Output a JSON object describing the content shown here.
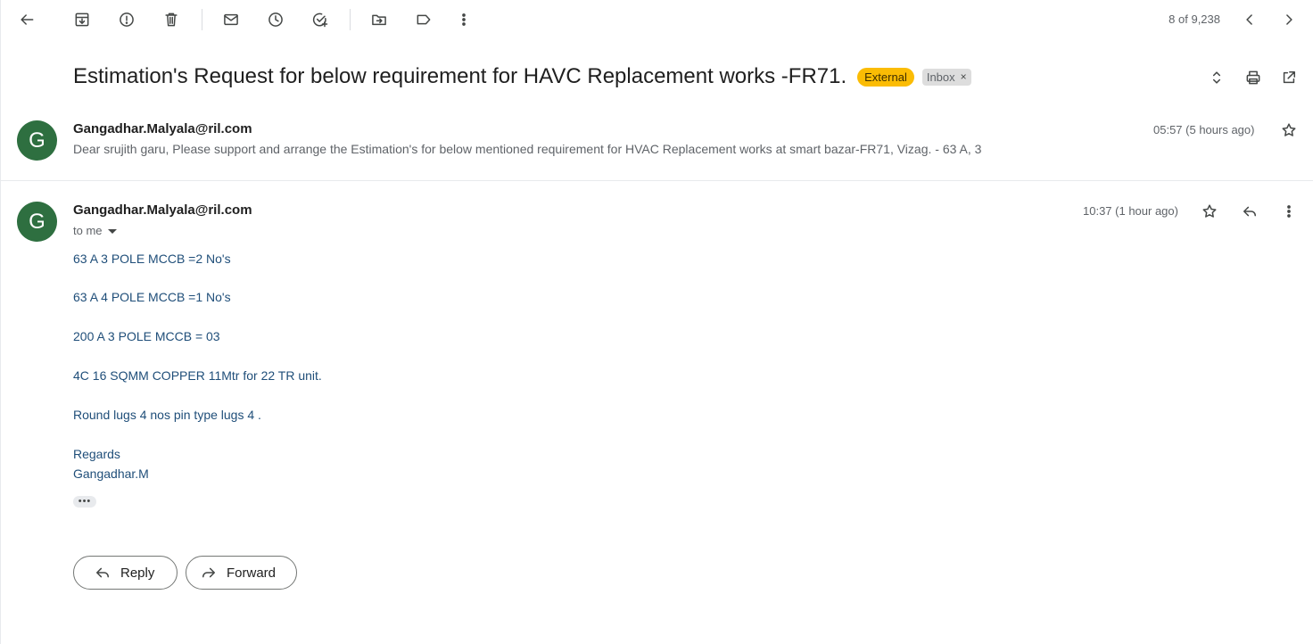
{
  "toolbar": {
    "icons": [
      "back-arrow-icon",
      "archive-icon",
      "report-spam-icon",
      "delete-icon",
      "mark-unread-icon",
      "snooze-icon",
      "add-to-tasks-icon",
      "move-to-icon",
      "label-icon",
      "more-vertical-icon"
    ],
    "counter": "8 of 9,238"
  },
  "subject": {
    "title": "Estimation's Request for below requirement for HAVC Replacement works -FR71.",
    "badge_external": "External",
    "badge_inbox": "Inbox",
    "badge_remove": "×"
  },
  "messages": [
    {
      "avatar_letter": "G",
      "avatar_color": "#2e6f40",
      "sender": "Gangadhar.Malyala@ril.com",
      "time": "05:57 (5 hours ago)",
      "snippet": "Dear srujith garu, Please support and arrange the Estimation's for below mentioned requirement for HVAC Replacement works at smart bazar-FR71, Vizag. - 63 A, 3"
    },
    {
      "avatar_letter": "G",
      "avatar_color": "#2e6f40",
      "sender": "Gangadhar.Malyala@ril.com",
      "time": "10:37 (1 hour ago)",
      "to": "to me",
      "body_lines": [
        "63 A 3 POLE MCCB =2 No's",
        "63 A 4 POLE MCCB =1 No's",
        "200 A 3 POLE MCCB = 03",
        "4C 16 SQMM COPPER 11Mtr for 22 TR unit.",
        "Round lugs 4 nos pin type lugs 4 .",
        "Regards",
        "Gangadhar.M"
      ],
      "ellipsis": "•••"
    }
  ],
  "actions": {
    "reply": "Reply",
    "forward": "Forward"
  },
  "colors": {
    "accent_external": "#fbbc04",
    "body_text": "#1f4e79",
    "avatar": "#2e6f40"
  }
}
